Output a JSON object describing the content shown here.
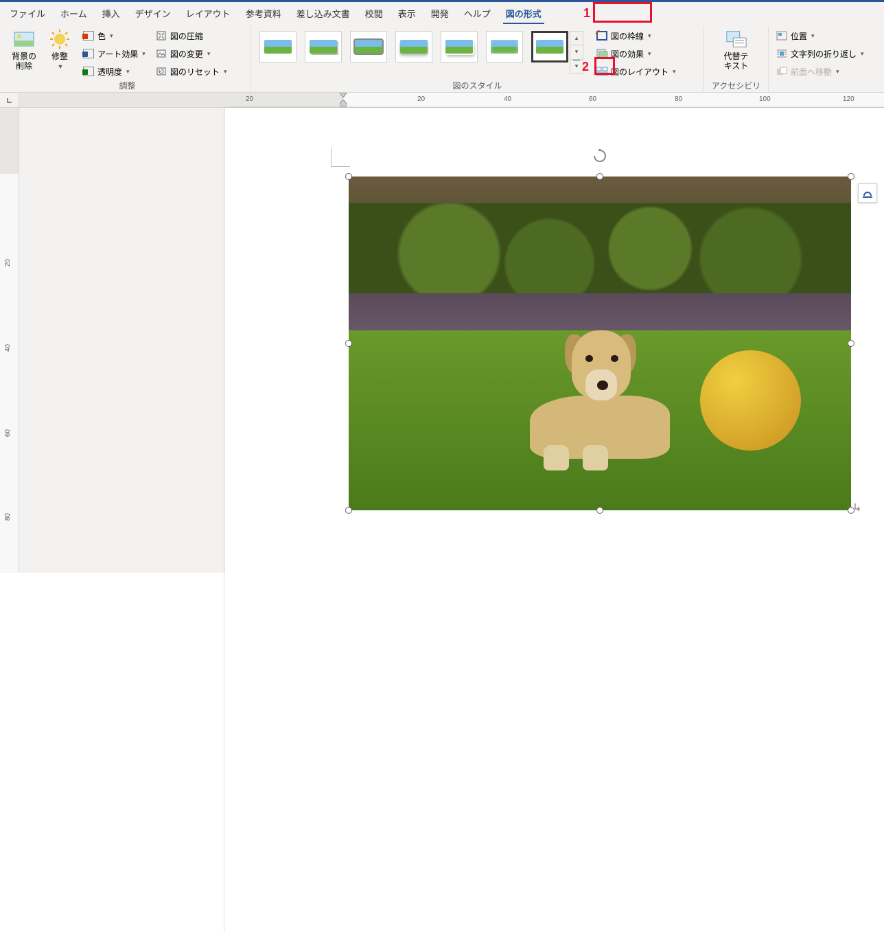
{
  "tabs": {
    "file": "ファイル",
    "home": "ホーム",
    "insert": "挿入",
    "design": "デザイン",
    "layout": "レイアウト",
    "references": "参考資料",
    "mailings": "差し込み文書",
    "review": "校閲",
    "view": "表示",
    "developer": "開発",
    "help": "ヘルプ",
    "pictureFormat": "図の形式"
  },
  "ribbon": {
    "adjust": {
      "removeBg": "背景の\n削除",
      "corrections": "修整",
      "color": "色",
      "artistic": "アート効果",
      "transparency": "透明度",
      "compress": "図の圧縮",
      "change": "図の変更",
      "reset": "図のリセット",
      "groupLabel": "調整"
    },
    "styles": {
      "border": "図の枠線",
      "effects": "図の効果",
      "layout": "図のレイアウト",
      "groupLabel": "図のスタイル"
    },
    "accessibility": {
      "altText": "代替テ\nキスト",
      "groupLabel": "アクセシビリティ"
    },
    "arrange": {
      "position": "位置",
      "wrap": "文字列の折り返し",
      "bringForward": "前面へ移動"
    }
  },
  "ruler": {
    "hNumbers": [
      20,
      20,
      40,
      60,
      80,
      100,
      120
    ],
    "vNumbers": [
      20,
      40,
      60,
      80
    ]
  },
  "annotations": {
    "num1": "1",
    "num2": "2"
  }
}
